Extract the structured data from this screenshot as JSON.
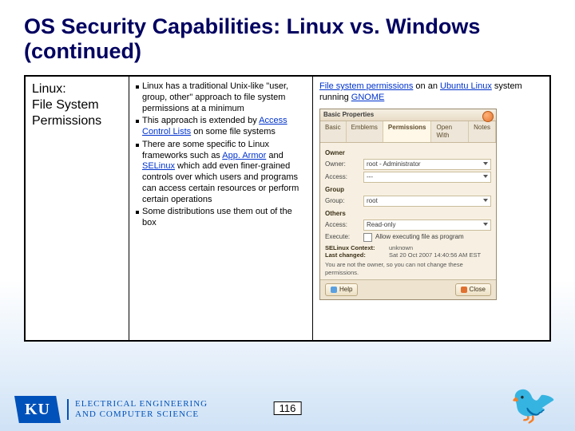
{
  "title": "OS Security Capabilities: Linux vs. Windows (continued)",
  "left_col": {
    "l1": "Linux:",
    "l2": "File System",
    "l3": "Permissions"
  },
  "bullets": {
    "b1_pre": "Linux has a traditional Unix-like \"user, group, other\" approach to file system permissions at a minimum",
    "b2_pre": "This approach is extended by ",
    "b2_link": "Access Control Lists",
    "b2_post": " on some file systems",
    "b3_pre": "There are some specific to Linux frameworks such as ",
    "b3_link1": "App. Armor",
    "b3_mid": " and ",
    "b3_link2": "SELinux",
    "b3_post": " which add even finer-grained controls over which users and programs can access certain resources or perform certain operations",
    "b4": "Some distributions use them out of the box"
  },
  "right": {
    "cap_link1": "File system permissions",
    "cap_mid1": " on an ",
    "cap_link2": "Ubuntu Linux",
    "cap_mid2": " system running ",
    "cap_link3": "GNOME"
  },
  "shot": {
    "window_title": "Basic Properties",
    "tabs": [
      "Basic",
      "Emblems",
      "Permissions",
      "Open With",
      "Notes"
    ],
    "owner_label": "Owner:",
    "owner_val": "root - Administrator",
    "access_label": "Access:",
    "access_val_rw": "---",
    "group_label": "Group:",
    "group_val": "root",
    "others_label": "Others",
    "access_ro": "Read-only",
    "exec_label": "Execute:",
    "exec_text": "Allow executing file as program",
    "sel_label": "SELinux Context:",
    "sel_val": "unknown",
    "changed_label": "Last changed:",
    "changed_val": "Sat 20 Oct 2007 14:40:56 AM EST",
    "note": "You are not the owner, so you can not change these permissions.",
    "help_btn": "Help",
    "close_btn": "Close"
  },
  "page_number": "116",
  "dept": {
    "l1": "ELECTRICAL ENGINEERING",
    "l2": "AND COMPUTER SCIENCE"
  },
  "jayhawk": "🐦"
}
